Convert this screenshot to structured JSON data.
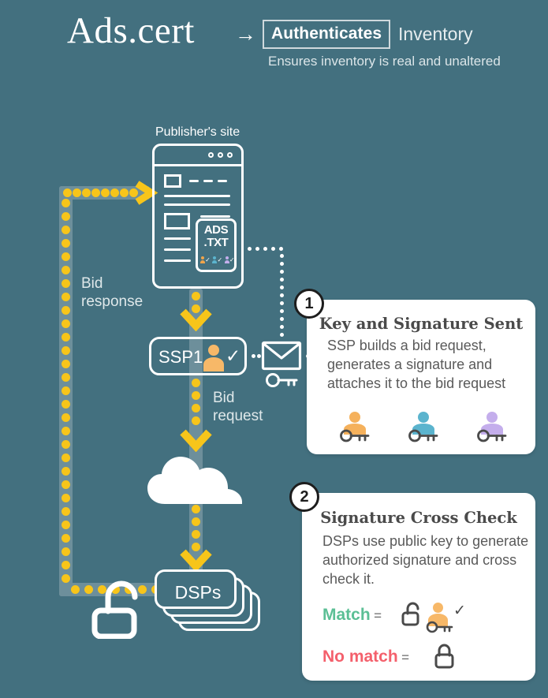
{
  "header": {
    "brand": "Ads.cert",
    "arrow_icon": "right-arrow-icon",
    "authenticates_label": "Authenticates",
    "inventory_label": "Inventory",
    "subtitle": "Ensures inventory is real and unaltered"
  },
  "diagram": {
    "publisher_label": "Publisher's site",
    "adstxt_line1": "ADS",
    "adstxt_line2": ".TXT",
    "adstxt_badges": [
      {
        "color": "#f0a44a",
        "check": "✓"
      },
      {
        "color": "#5bb4ce",
        "check": "✓"
      },
      {
        "color": "#c4aeec",
        "check": "✓"
      }
    ],
    "ssp_label": "SSP1",
    "ssp_check": "✓",
    "ssp_person_color": "#f7b868",
    "bid_response_label": "Bid\nresponse",
    "bid_response_line1": "Bid",
    "bid_response_line2": "response",
    "bid_request_line1": "Bid",
    "bid_request_line2": "request",
    "dsp_label": "DSPs",
    "envelope_icon": "envelope-icon",
    "key_icon": "key-icon",
    "cloud_icon": "cloud-icon",
    "padlock_icon": "open-padlock-icon",
    "flow_color": "#f7c51a",
    "track_color": "#6d8f9b"
  },
  "cards": [
    {
      "badge": "1",
      "title": "Key and Signature Sent",
      "body": "SSP builds a bid request, generates a signature and attaches it to the bid request",
      "icons": [
        {
          "name": "person-key-orange",
          "color": "#f5b15c"
        },
        {
          "name": "person-key-blue",
          "color": "#5bb4ce"
        },
        {
          "name": "person-key-purple",
          "color": "#c4aeec"
        }
      ]
    },
    {
      "badge": "2",
      "title": "Signature Cross Check",
      "body": "DSPs use public key to generate authorized signature and cross check it.",
      "match_word": "Match",
      "match_color": "#5bbf95",
      "match_equals": "=",
      "match_check": "✓",
      "nomatch_word": "No match",
      "nomatch_color": "#f4606c",
      "nomatch_equals": "="
    }
  ],
  "colors": {
    "background": "#43707f",
    "accent_yellow": "#f7c51a",
    "white": "#ffffff",
    "track_gray": "#6d8f9b",
    "person_orange": "#f7b868",
    "green": "#5bbf95",
    "red": "#f4606c"
  }
}
